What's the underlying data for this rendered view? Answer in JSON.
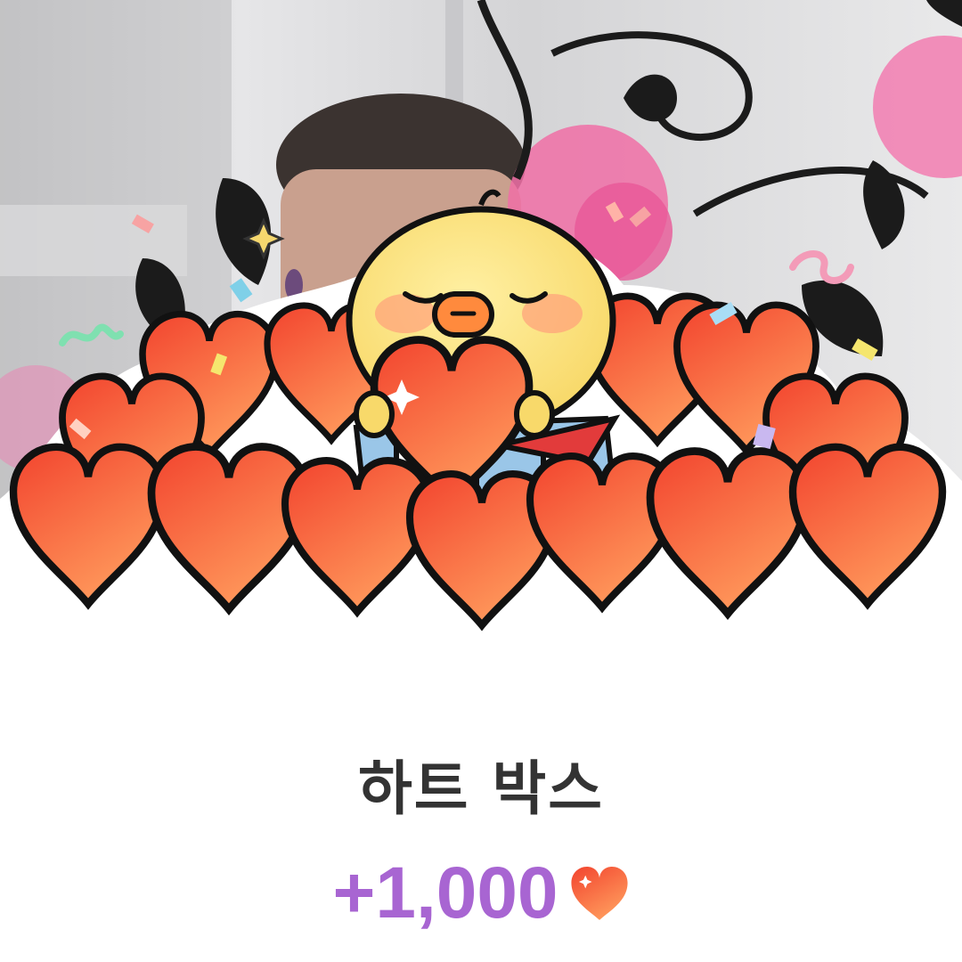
{
  "gift": {
    "title": "하트 박스",
    "amount": "+1,000",
    "currency_icon": "heart-icon"
  },
  "colors": {
    "amount": "#a865d2",
    "title": "#333333",
    "heart_light": "#ff8c5a",
    "heart_dark": "#f2432e",
    "chick": "#fbe27a"
  },
  "illustration": {
    "character": "chick",
    "props": [
      "hearts-pile",
      "gift-box",
      "confetti"
    ]
  }
}
